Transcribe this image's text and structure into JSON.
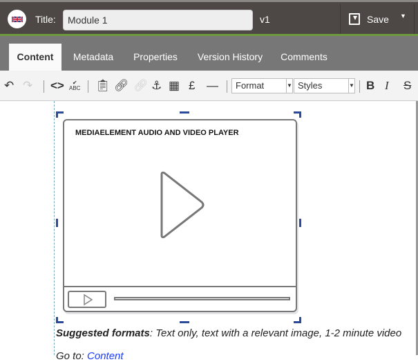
{
  "header": {
    "title_label": "Title:",
    "title_value": "Module 1",
    "version": "v1",
    "save_label": "Save"
  },
  "tabs": [
    {
      "label": "Content",
      "active": true
    },
    {
      "label": "Metadata"
    },
    {
      "label": "Properties"
    },
    {
      "label": "Version History"
    },
    {
      "label": "Comments"
    }
  ],
  "toolbar": {
    "format": "Format",
    "styles": "Styles",
    "buttons": [
      "undo",
      "redo",
      "source-code",
      "spellcheck",
      "paste",
      "link",
      "unlink",
      "anchor",
      "table",
      "pound-sign",
      "horizontal-rule",
      "bold",
      "italic",
      "strikethrough"
    ]
  },
  "content": {
    "player_title": "MEDIAELEMENT AUDIO AND VIDEO PLAYER",
    "suggested_bold": "Suggested formats",
    "suggested_text": ": Text only, text with a relevant image, 1-2 minute video",
    "goto_text": "Go to: ",
    "goto_link": "Content"
  },
  "colors": {
    "header": "#4d4845",
    "accent": "#6c9a3d",
    "tabbar": "#777777",
    "link": "#1a3cff",
    "handles": "#2b4a9a"
  }
}
